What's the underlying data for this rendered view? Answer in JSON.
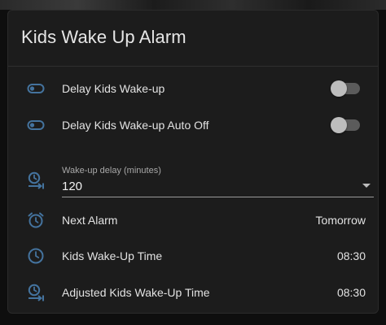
{
  "card": {
    "title": "Kids Wake Up Alarm"
  },
  "colors": {
    "icon": "#44739e",
    "card_bg": "#1c1c1c",
    "text": "#e2e2e2",
    "toggle_track": "#5b5b5b",
    "toggle_knob": "#bdbdbd"
  },
  "rows": {
    "delay_wakeup": {
      "label": "Delay Kids Wake-up",
      "icon": "toggle-switch-off-outline-icon",
      "state": "off"
    },
    "delay_wakeup_auto_off": {
      "label": "Delay Kids Wake-up Auto Off",
      "icon": "toggle-switch-off-outline-icon",
      "state": "off"
    },
    "wakeup_delay": {
      "caption": "Wake-up delay (minutes)",
      "value": "120",
      "icon": "clock-forward-icon"
    },
    "next_alarm": {
      "label": "Next Alarm",
      "value": "Tomorrow",
      "icon": "alarm-clock-icon"
    },
    "wakeup_time": {
      "label": "Kids Wake-Up Time",
      "value": "08:30",
      "icon": "clock-icon"
    },
    "adjusted_wakeup_time": {
      "label": "Adjusted Kids Wake-Up Time",
      "value": "08:30",
      "icon": "clock-forward-icon"
    }
  }
}
